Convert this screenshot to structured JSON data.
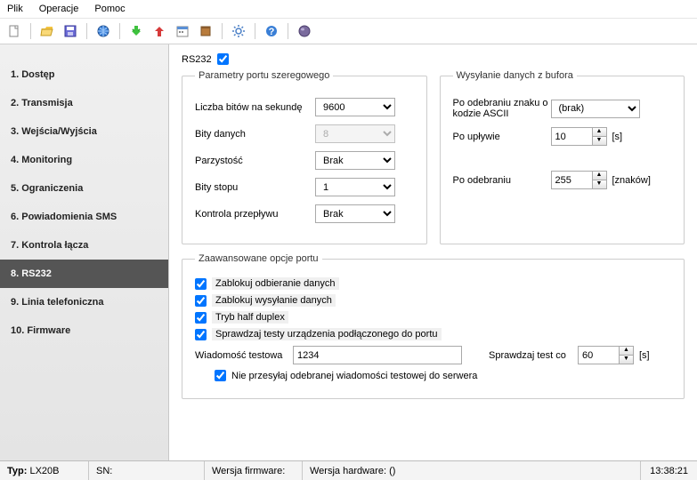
{
  "menu": {
    "file": "Plik",
    "operations": "Operacje",
    "help": "Pomoc"
  },
  "sidebar": {
    "items": [
      {
        "label": "1. Dostęp"
      },
      {
        "label": "2. Transmisja"
      },
      {
        "label": "3. Wejścia/Wyjścia"
      },
      {
        "label": "4. Monitoring"
      },
      {
        "label": "5. Ograniczenia"
      },
      {
        "label": "6. Powiadomienia SMS"
      },
      {
        "label": "7. Kontrola łącza"
      },
      {
        "label": "8. RS232"
      },
      {
        "label": "9. Linia telefoniczna"
      },
      {
        "label": "10. Firmware"
      }
    ],
    "active": 7
  },
  "rs232": {
    "title": "RS232",
    "enabled": true
  },
  "serial": {
    "legend": "Parametry portu szeregowego",
    "baud_label": "Liczba bitów na sekundę",
    "baud": "9600",
    "databits_label": "Bity danych",
    "databits": "8",
    "parity_label": "Parzystość",
    "parity": "Brak",
    "stopbits_label": "Bity stopu",
    "stopbits": "1",
    "flow_label": "Kontrola przepływu",
    "flow": "Brak"
  },
  "buffer": {
    "legend": "Wysyłanie danych z bufora",
    "ascii_label": "Po odebraniu znaku o kodzie ASCII",
    "ascii": "(brak)",
    "after_time_label": "Po upływie",
    "after_time": "10",
    "after_time_unit": "[s]",
    "after_recv_label": "Po odebraniu",
    "after_recv": "255",
    "after_recv_unit": "[znaków]"
  },
  "adv": {
    "legend": "Zaawansowane opcje portu",
    "block_rx": "Zablokuj odbieranie danych",
    "block_tx": "Zablokuj wysyłanie danych",
    "half_duplex": "Tryb half duplex",
    "check_tests": "Sprawdzaj testy urządzenia podłączonego do portu",
    "test_msg_label": "Wiadomość testowa",
    "test_msg": "1234",
    "check_every_label": "Sprawdzaj test co",
    "check_every": "60",
    "check_every_unit": "[s]",
    "no_forward": "Nie przesyłaj odebranej wiadomości testowej do serwera"
  },
  "status": {
    "type_label": "Typ:",
    "type": "LX20B",
    "sn_label": "SN:",
    "sn": "",
    "fw_label": "Wersja firmware:",
    "fw": "",
    "hw_label": "Wersja hardware:",
    "hw": "()",
    "time": "13:38:21"
  }
}
